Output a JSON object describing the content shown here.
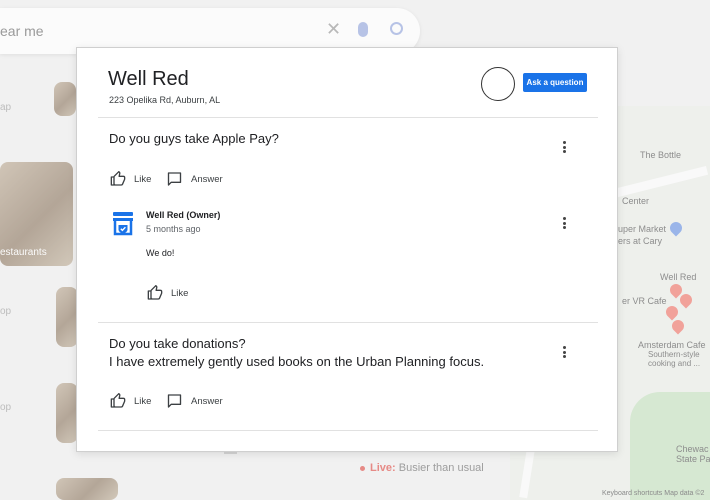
{
  "background": {
    "search_query_fragment": "ear me",
    "thumbnail_caption": "estaurants",
    "side_fragments": [
      "ap",
      "op",
      "op"
    ],
    "map_labels": [
      "The Bottle",
      "Center",
      "uper Market",
      "ers at Cary",
      "Well Red",
      "er VR Cafe",
      "Amsterdam Cafe",
      "Southern-style",
      "cooking and ...",
      "Chewac",
      "State Park"
    ],
    "map_credit": "Keyboard shortcuts    Map data ©2",
    "live_label": "Live:",
    "live_status": "Busier than usual"
  },
  "modal": {
    "title": "Well Red",
    "address": "223 Opelika Rd, Auburn, AL",
    "ask_button": "Ask a question"
  },
  "questions": [
    {
      "text": "Do you guys take Apple Pay?",
      "like_label": "Like",
      "answer_label": "Answer",
      "answer": {
        "author": "Well Red (Owner)",
        "time": "5 months ago",
        "text": "We do!",
        "like_label": "Like"
      }
    },
    {
      "text_line1": "Do you take donations?",
      "text_line2": "I have extremely gently used books on the Urban Planning focus.",
      "like_label": "Like",
      "answer_label": "Answer"
    }
  ],
  "colors": {
    "accent": "#1a73e8",
    "owner_icon": "#1a73e8",
    "live": "#e68a86"
  },
  "icons": {
    "like": "thumbs-up-icon",
    "answer": "comment-icon",
    "menu": "more-vert-icon",
    "owner": "storefront-verified-icon"
  }
}
